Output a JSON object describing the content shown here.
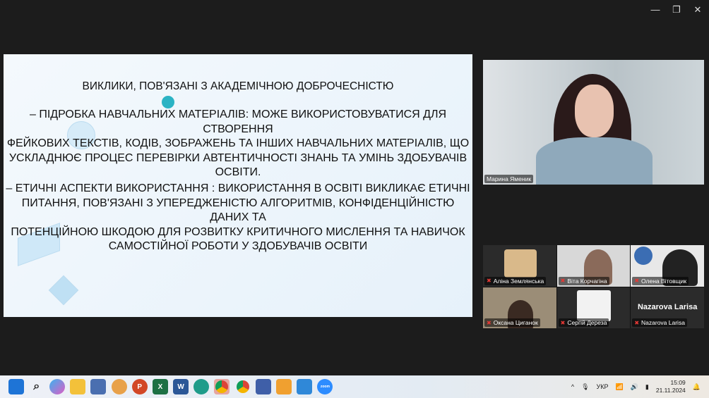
{
  "window": {
    "minimize": "—",
    "restore": "❐",
    "close": "✕"
  },
  "slide": {
    "title": "ВИКЛИКИ, ПОВ'ЯЗАНІ  З АКАДЕМІЧНОЮ ДОБРОЧЕСНІСТЮ",
    "p1": [
      "– ПІДРОБКА НАВЧАЛЬНИХ МАТЕРІАЛІВ: МОЖЕ ВИКОРИСТОВУВАТИСЯ ДЛЯ СТВОРЕННЯ",
      "ФЕЙКОВИХ ТЕКСТІВ, КОДІВ, ЗОБРАЖЕНЬ ТА ІНШИХ НАВЧАЛЬНИХ МАТЕРІАЛІВ, ЩО",
      "УСКЛАДНЮЄ ПРОЦЕС ПЕРЕВІРКИ АВТЕНТИЧНОСТІ ЗНАНЬ ТА УМІНЬ ЗДОБУВАЧІВ ОСВІТИ."
    ],
    "p2": [
      "– ЕТИЧНІ АСПЕКТИ ВИКОРИСТАННЯ : ВИКОРИСТАННЯ В ОСВІТІ ВИКЛИКАЄ ЕТИЧНІ",
      "ПИТАННЯ, ПОВ'ЯЗАНІ З УПЕРЕДЖЕНІСТЮ АЛГОРИТМІВ, КОНФІДЕНЦІЙНІСТЮ ДАНИХ ТА",
      "ПОТЕНЦІЙНОЮ ШКОДОЮ ДЛЯ РОЗВИТКУ КРИТИЧНОГО МИСЛЕННЯ ТА НАВИЧОК",
      "САМОСТІЙНОЇ РОБОТИ У ЗДОБУВАЧІВ ОСВІТИ"
    ]
  },
  "speaker": {
    "name": "Марина  Яменик"
  },
  "participants": [
    {
      "name": "Аліна Землянська"
    },
    {
      "name": "Віта Корчагіна"
    },
    {
      "name": "Олена Вітовщик"
    },
    {
      "name": "Оксана Циганок"
    },
    {
      "name": "Сергій Дереза"
    },
    {
      "name": "Nazarova Larisa",
      "display": "Nazarova Larisa"
    }
  ],
  "taskbar": {
    "apps": [
      "windows-start",
      "search",
      "copilot",
      "file-explorer",
      "app",
      "app",
      "powerpoint",
      "excel",
      "word",
      "edge",
      "chrome",
      "chrome",
      "save",
      "app",
      "app",
      "zoom"
    ]
  },
  "tray": {
    "chevron": "^",
    "lang": "УКР",
    "time": "15:09",
    "date": "21.11.2024"
  }
}
